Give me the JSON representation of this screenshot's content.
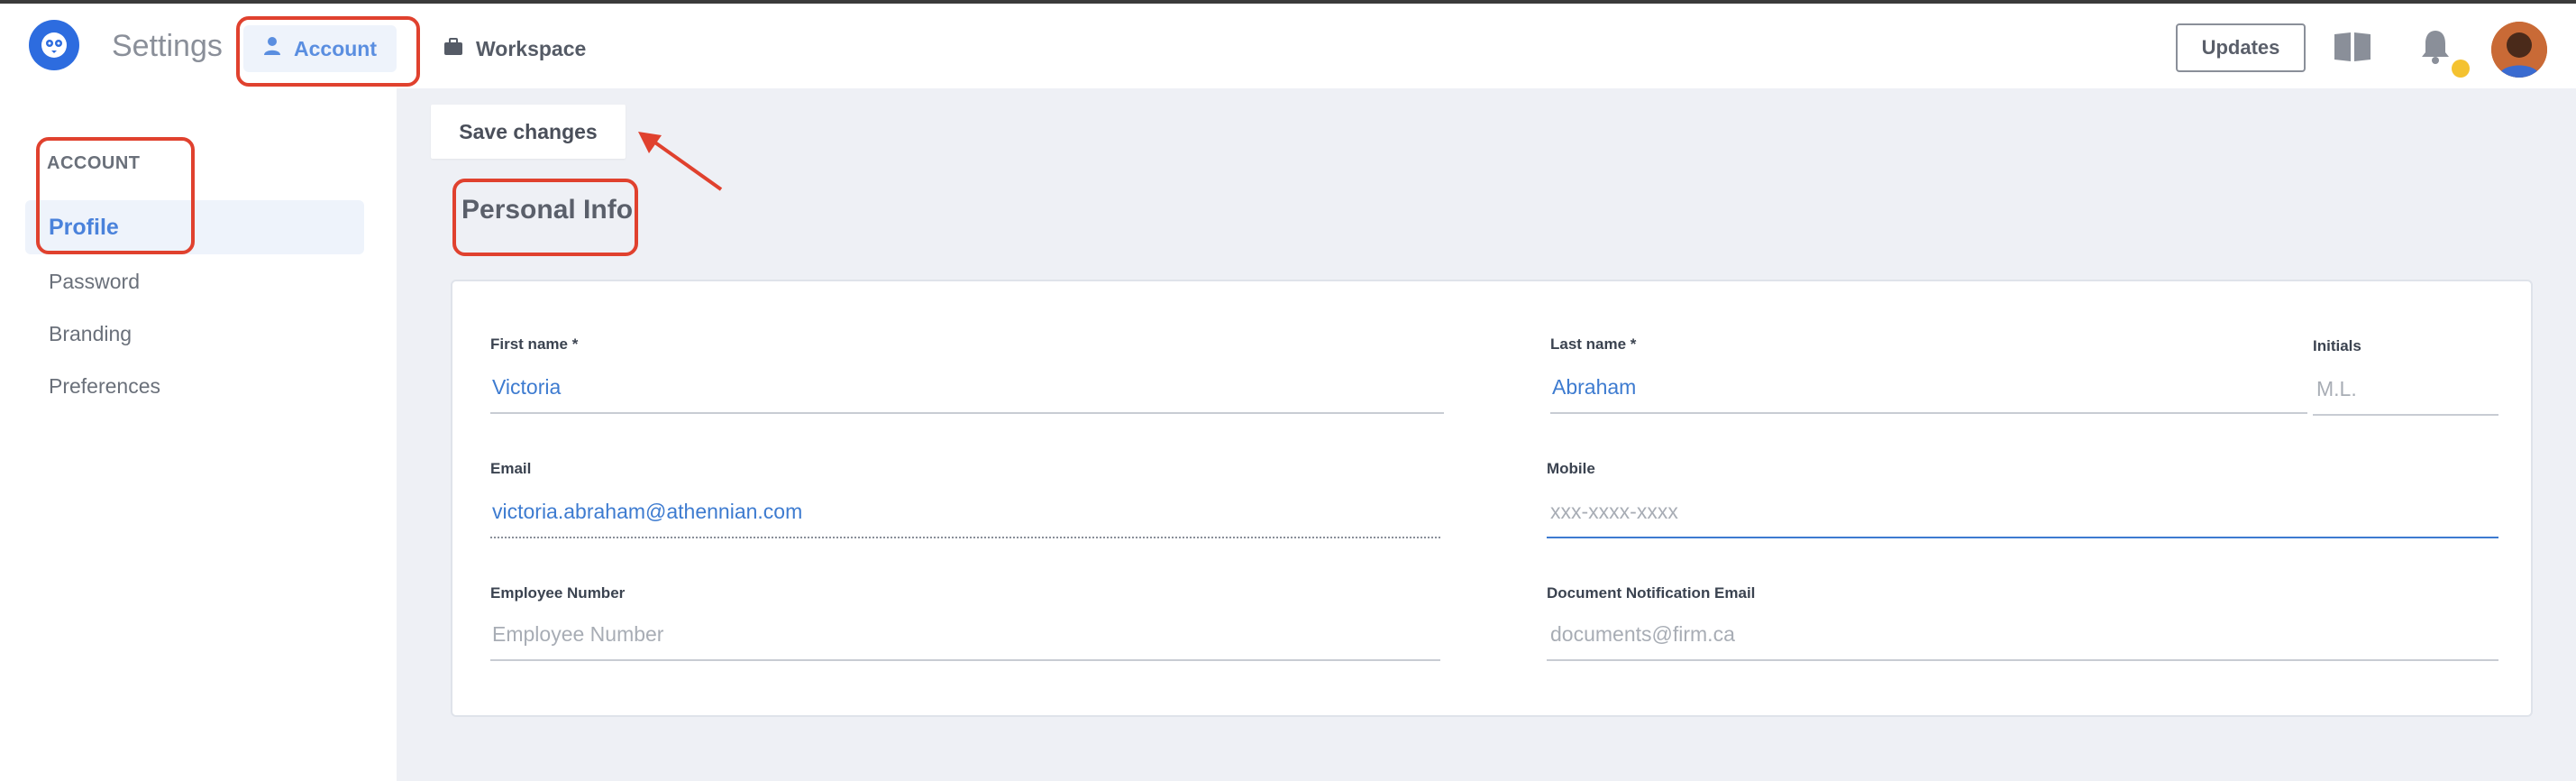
{
  "header": {
    "title": "Settings",
    "tabs": [
      {
        "label": "Account",
        "icon": "user-icon",
        "active": true
      },
      {
        "label": "Workspace",
        "icon": "briefcase-icon",
        "active": false
      }
    ],
    "updates_label": "Updates",
    "icons": [
      "logo-icon",
      "book-icon",
      "bell-icon",
      "avatar"
    ],
    "notification_dot_color": "#f4c230"
  },
  "sidebar": {
    "heading": "ACCOUNT",
    "items": [
      {
        "label": "Profile",
        "active": true
      },
      {
        "label": "Password",
        "active": false
      },
      {
        "label": "Branding",
        "active": false
      },
      {
        "label": "Preferences",
        "active": false
      }
    ]
  },
  "toolbar": {
    "save_label": "Save changes"
  },
  "main": {
    "section_title": "Personal Info",
    "fields": {
      "first_name": {
        "label": "First name *",
        "value": "Victoria"
      },
      "last_name": {
        "label": "Last name *",
        "value": "Abraham"
      },
      "initials": {
        "label": "Initials",
        "placeholder": "M.L."
      },
      "email": {
        "label": "Email",
        "value": "victoria.abraham@athennian.com"
      },
      "mobile": {
        "label": "Mobile",
        "placeholder": "xxx-xxxx-xxxx"
      },
      "employee_number": {
        "label": "Employee Number",
        "placeholder": "Employee Number"
      },
      "doc_email": {
        "label": "Document Notification Email",
        "placeholder": "documents@firm.ca"
      }
    }
  },
  "colors": {
    "accent": "#3d7bd0",
    "annotation": "#e0412e",
    "brand": "#2d6cdf"
  }
}
